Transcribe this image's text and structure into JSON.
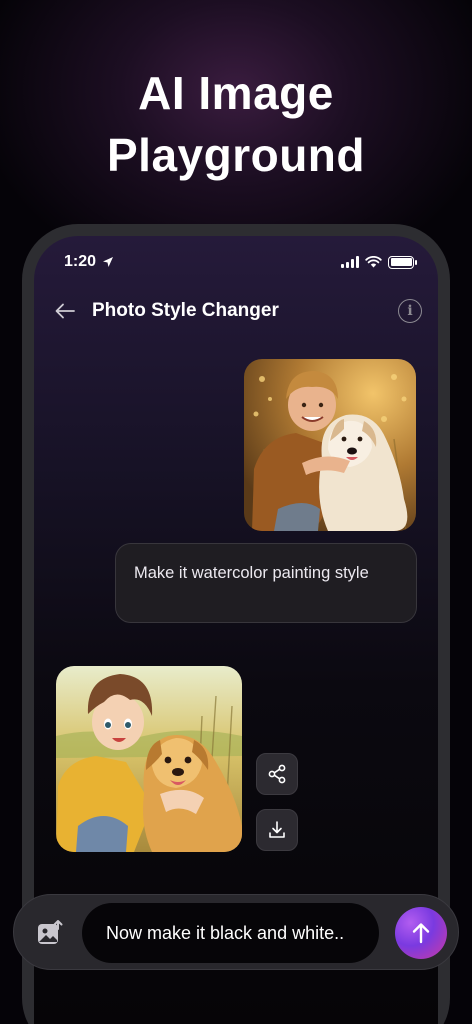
{
  "headline": {
    "line1": "AI Image",
    "line2": "Playground"
  },
  "status_bar": {
    "time": "1:20",
    "icons": [
      "location-arrow-icon",
      "signal-bars-icon",
      "wifi-icon",
      "battery-icon"
    ]
  },
  "app_bar": {
    "title": "Photo Style Changer",
    "back_icon": "arrow-left-icon",
    "info_icon": "info-icon",
    "info_glyph": "i"
  },
  "chat": {
    "user_message": "Make it watercolor painting style",
    "actions": [
      "share-icon",
      "download-icon"
    ]
  },
  "composer": {
    "gallery_icon": "image-upload-icon",
    "prompt_text": "Now make it black and white..",
    "send_icon": "arrow-up-icon"
  },
  "colors": {
    "background": "#050308",
    "bubble": "#1f1d22",
    "send_gradient_start": "#b25df0",
    "send_gradient_end": "#cc3aa3"
  }
}
